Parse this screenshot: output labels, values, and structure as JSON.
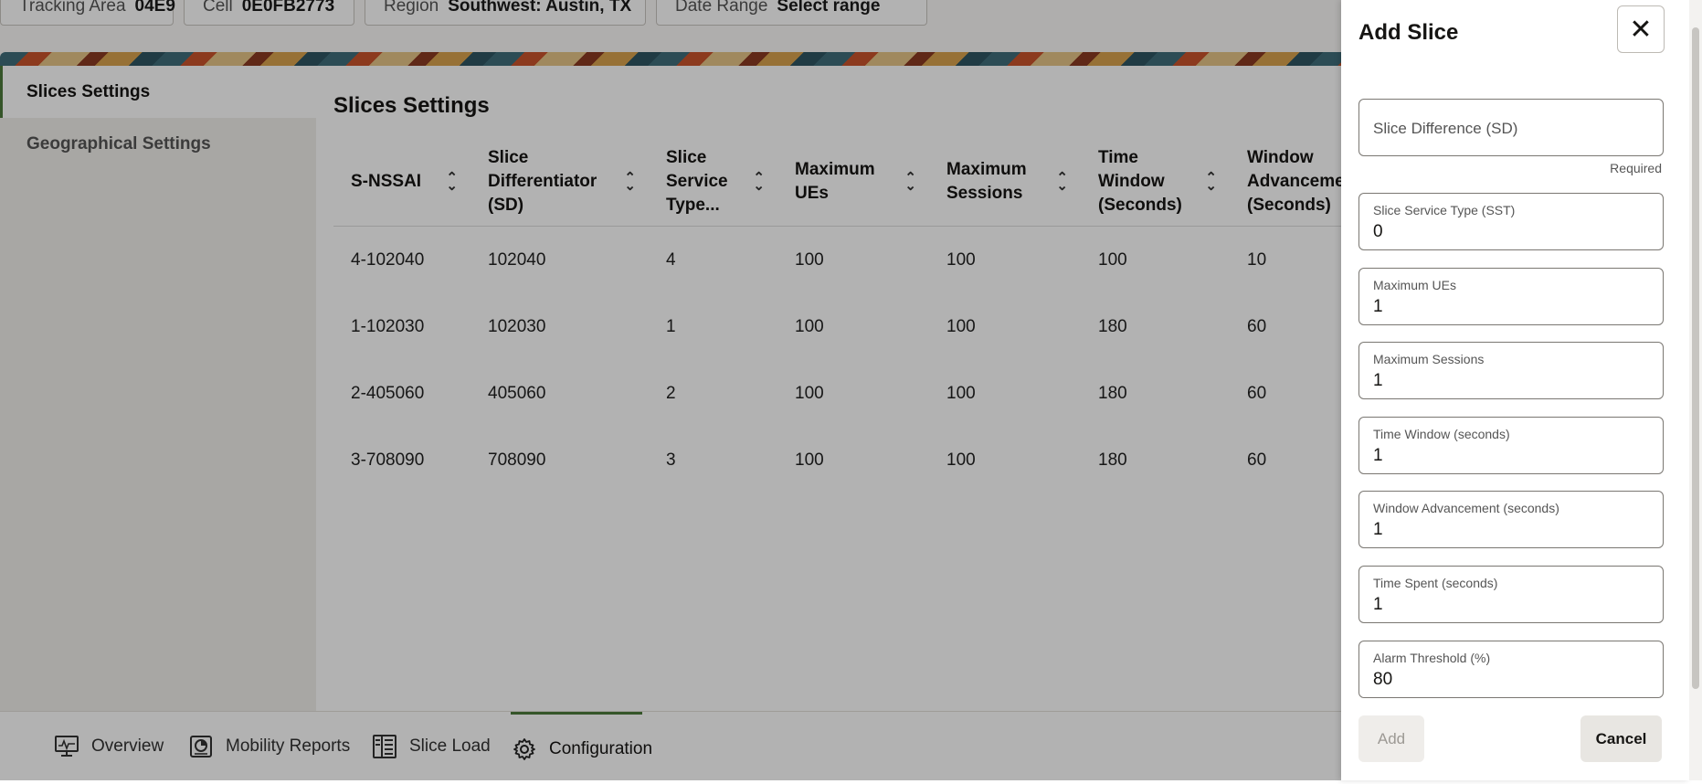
{
  "filters": [
    {
      "key": "Tracking Area",
      "value": "04E9"
    },
    {
      "key": "Cell",
      "value": "0E0FB2773"
    },
    {
      "key": "Region",
      "value": "Southwest: Austin, TX"
    },
    {
      "key": "Date Range",
      "value": "Select range"
    }
  ],
  "sidebar": {
    "items": [
      {
        "label": "Slices Settings",
        "active": true
      },
      {
        "label": "Geographical Settings",
        "active": false
      }
    ]
  },
  "main": {
    "title": "Slices Settings",
    "columns": [
      "S-NSSAI",
      "Slice Differentiator (SD)",
      "Slice Service Type...",
      "Maximum UEs",
      "Maximum Sessions",
      "Time Window (Seconds)",
      "Window Advanceme (Seconds)"
    ],
    "rows": [
      [
        "4-102040",
        "102040",
        "4",
        "100",
        "100",
        "100",
        "10"
      ],
      [
        "1-102030",
        "102030",
        "1",
        "100",
        "100",
        "180",
        "60"
      ],
      [
        "2-405060",
        "405060",
        "2",
        "100",
        "100",
        "180",
        "60"
      ],
      [
        "3-708090",
        "708090",
        "3",
        "100",
        "100",
        "180",
        "60"
      ]
    ]
  },
  "bottom_nav": [
    {
      "label": "Overview",
      "icon": "monitor-icon",
      "active": false
    },
    {
      "label": "Mobility Reports",
      "icon": "report-icon",
      "active": false
    },
    {
      "label": "Slice Load",
      "icon": "slice-load-icon",
      "active": false
    },
    {
      "label": "Configuration",
      "icon": "gear-icon",
      "active": true
    }
  ],
  "drawer": {
    "title": "Add Slice",
    "close_icon": "close-icon",
    "sd_placeholder": "Slice Difference (SD)",
    "required_text": "Required",
    "fields": [
      {
        "label": "Slice Service Type (SST)",
        "value": "0"
      },
      {
        "label": "Maximum UEs",
        "value": "1"
      },
      {
        "label": "Maximum Sessions",
        "value": "1"
      },
      {
        "label": "Time Window (seconds)",
        "value": "1"
      },
      {
        "label": "Window Advancement (seconds)",
        "value": "1"
      },
      {
        "label": "Time Spent (seconds)",
        "value": "1"
      },
      {
        "label": "Alarm Threshold (%)",
        "value": "80"
      }
    ],
    "add_label": "Add",
    "cancel_label": "Cancel"
  },
  "colors": {
    "accent": "#4c7a3b",
    "scrim": "#000000"
  }
}
